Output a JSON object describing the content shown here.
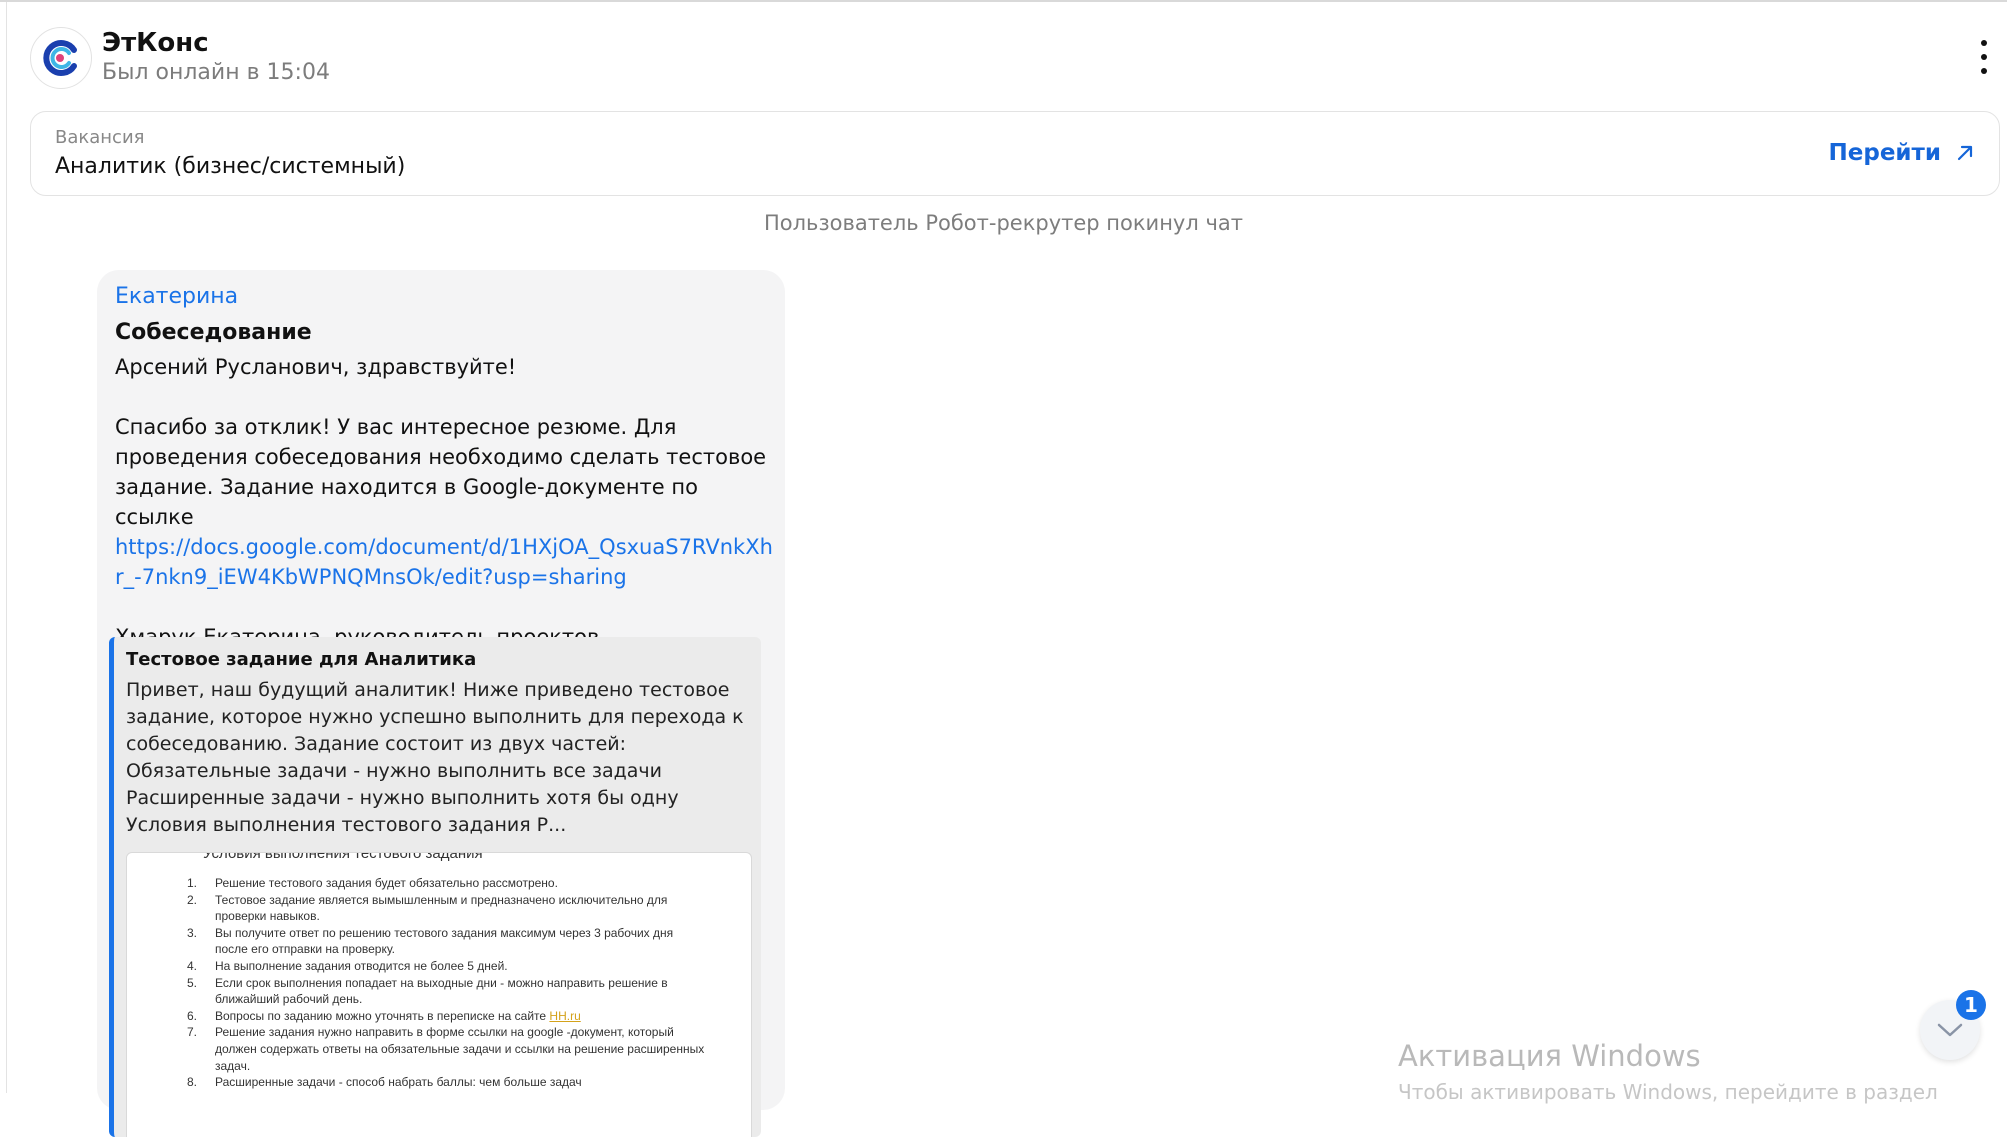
{
  "header": {
    "title": "ЭтКонс",
    "status": "Был онлайн в 15:04"
  },
  "vacancy": {
    "label": "Вакансия",
    "title": "Аналитик (бизнес/системный)",
    "goto_label": "Перейти"
  },
  "system_message": "Пользователь Робот-рекрутер покинул чат",
  "message": {
    "sender": "Екатерина",
    "subject": "Собеседование",
    "greeting": "Арсений Русланович, здравствуйте!",
    "paragraph": "Спасибо за отклик! У вас интересное резюме. Для проведения собеседования необходимо сделать тестовое задание. Задание находится в Google-документе по ссылке",
    "link": "https://docs.google.com/document/d/1HXjOA_QsxuaS7RVnkXhr_-7nkn9_iEW4KbWPNQMnsOk/edit?usp=sharing",
    "signature": "Хмарук Екатерина, руководитель проектов"
  },
  "preview": {
    "title": "Тестовое задание для Аналитика",
    "description": "Привет, наш будущий аналитик! Ниже приведено тестовое задание, которое нужно успешно выполнить для перехода к собеседованию. Задание состоит из двух частей: Обязательные задачи - нужно выполнить все задачи Расширенные задачи - нужно выполнить хотя бы одну Условия выполнения тестового задания Р...",
    "image_heading": "Условия выполнения тестового задания",
    "image_items": [
      {
        "num": "1.",
        "text": "Решение тестового задания будет обязательно рассмотрено."
      },
      {
        "num": "2.",
        "text": "Тестовое задание является вымышленным и предназначено исключительно для проверки навыков."
      },
      {
        "num": "3.",
        "text": "Вы получите ответ по решению тестового задания максимум через 3 рабочих дня после его отправки на проверку."
      },
      {
        "num": "4.",
        "text": "На выполнение задания отводится не более 5 дней."
      },
      {
        "num": "5.",
        "text": "Если срок выполнения попадает на выходные дни - можно направить решение в ближайший рабочий день."
      },
      {
        "num": "6.",
        "text": "Вопросы по заданию можно уточнять в переписке на сайте",
        "link": "HH.ru"
      },
      {
        "num": "7.",
        "text": "Решение задания нужно направить в форме ссылки на google -документ, который должен содержать ответы на обязательные задачи и ссылки на решение расширенных задач."
      },
      {
        "num": "8.",
        "text": "Расширенные задачи - способ набрать баллы: чем больше задач"
      }
    ]
  },
  "watermark": {
    "title": "Активация Windows",
    "subtitle": "Чтобы активировать Windows, перейдите в раздел"
  },
  "unread_count": "1",
  "colors": {
    "accent": "#1a73e8",
    "bubble": "#f4f4f5",
    "preview_bg": "#ebebeb"
  },
  "icons": {
    "avatar": "etkons-logo",
    "goto": "arrow-up-right-icon",
    "menu": "kebab-icon",
    "scroll": "chevron-down-icon"
  }
}
